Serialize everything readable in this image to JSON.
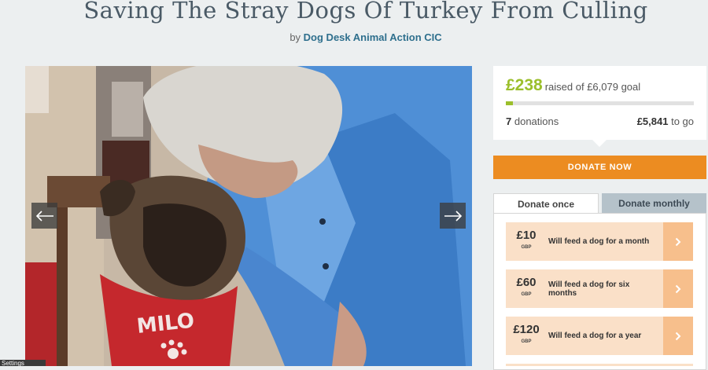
{
  "campaign": {
    "title": "Saving The Stray Dogs Of Turkey From Culling",
    "by_prefix": "by",
    "organizer": "Dog Desk Animal Action CIC"
  },
  "media": {
    "collar_text": "MILO",
    "settings_label": "Settings"
  },
  "progress": {
    "raised": "£238",
    "raised_suffix": "raised of £6,079 goal",
    "donation_count": "7",
    "donations_label": "donations",
    "remaining": "£5,841",
    "remaining_label": "to go",
    "fraction": 0.039
  },
  "donate_now_label": "DONATE NOW",
  "tabs": {
    "once": "Donate once",
    "monthly": "Donate monthly"
  },
  "options": [
    {
      "amount": "£10",
      "currency": "GBP",
      "description": "Will feed a dog for a month"
    },
    {
      "amount": "£60",
      "currency": "GBP",
      "description": "Will feed a dog for six months"
    },
    {
      "amount": "£120",
      "currency": "GBP",
      "description": "Will feed a dog for a year"
    }
  ],
  "colors": {
    "accent_green": "#9bbf2b",
    "donate_orange": "#ec8c21",
    "option_bg": "#fae0c8",
    "option_arrow_bg": "#f7bf8c",
    "title_color": "#4a5a66",
    "link_color": "#2e6f8d"
  },
  "icons": {
    "prev": "arrow-left-icon",
    "next": "arrow-right-icon",
    "option_go": "chevron-right-icon"
  }
}
